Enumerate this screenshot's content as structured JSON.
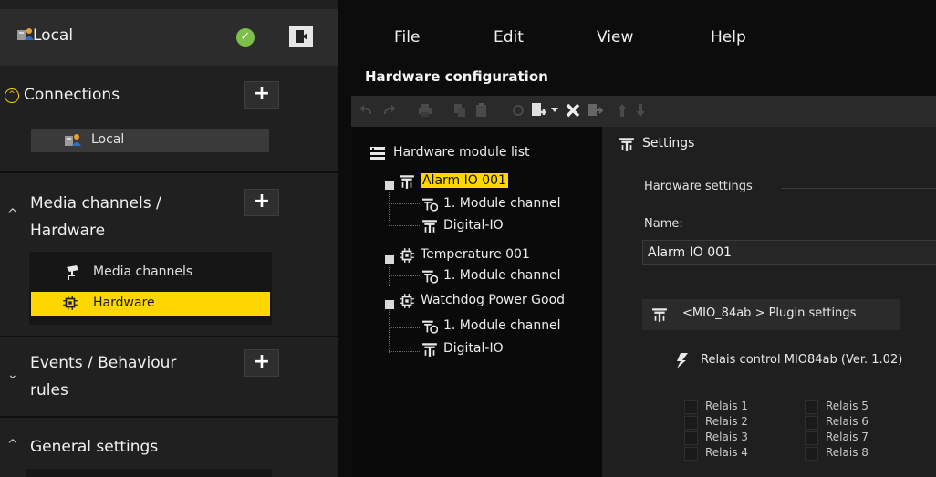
{
  "sidebar": {
    "header": {
      "title": "Local"
    },
    "sections": {
      "connections": {
        "title": "Connections",
        "items": [
          {
            "label": "Local"
          }
        ]
      },
      "media": {
        "title_line1": "Media channels /",
        "title_line2": "Hardware",
        "items": [
          {
            "label": "Media channels"
          },
          {
            "label": "Hardware"
          }
        ]
      },
      "events": {
        "title_line1": "Events / Behaviour",
        "title_line2": "rules"
      },
      "general": {
        "title": "General settings"
      }
    },
    "plus_label": "+"
  },
  "menu": {
    "file": "File",
    "edit": "Edit",
    "view": "View",
    "help": "Help"
  },
  "panel": {
    "title": "Hardware configuration"
  },
  "tree": {
    "root": "Hardware module list",
    "nodes": [
      {
        "label": "Alarm IO 001",
        "children": [
          "1. Module channel",
          "Digital-IO"
        ]
      },
      {
        "label": "Temperature 001",
        "children": [
          "1. Module channel"
        ]
      },
      {
        "label": "Watchdog Power Good",
        "children": [
          "1. Module channel",
          "Digital-IO"
        ]
      }
    ]
  },
  "settings": {
    "header": "Settings",
    "group_label": "Hardware settings",
    "name_label": "Name:",
    "name_value": "Alarm IO 001",
    "plugin_settings": "<MIO_84ab > Plugin settings",
    "relais_control": "Relais control MIO84ab (Ver. 1.02)",
    "relais": [
      "Relais 1",
      "Relais 2",
      "Relais 3",
      "Relais 4",
      "Relais 5",
      "Relais 6",
      "Relais 7",
      "Relais 8"
    ]
  },
  "colors": {
    "accent": "#ffd700",
    "ok": "#7cc04a",
    "sidebar": "#202020",
    "background": "#0c0c0c"
  },
  "icons": [
    "local-server-icon",
    "status-ok-icon",
    "logout-icon",
    "undo-icon",
    "redo-icon",
    "print-icon",
    "copy-icon",
    "paste-icon",
    "refresh-icon",
    "add-module-icon",
    "delete-icon",
    "export-icon",
    "move-up-icon",
    "move-down-icon",
    "io-module-icon",
    "chip-icon",
    "channel-icon",
    "camera-icon",
    "relay-icon"
  ]
}
